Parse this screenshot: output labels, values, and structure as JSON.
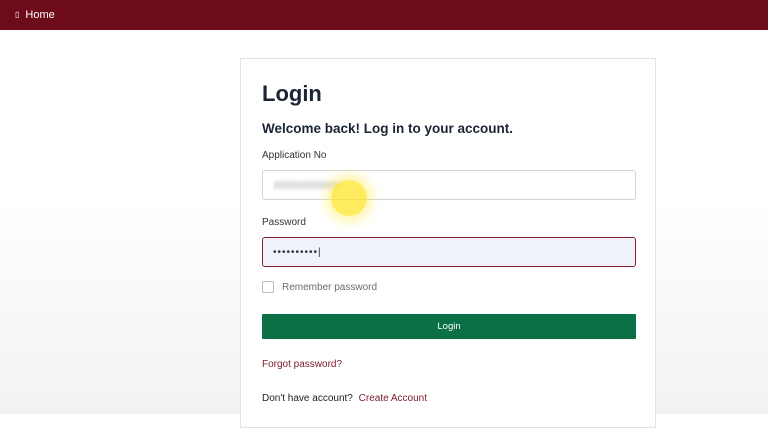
{
  "nav": {
    "home_icon": "home-icon",
    "home_icon_glyph": "▯",
    "home_label": "Home"
  },
  "login": {
    "title": "Login",
    "subtitle": "Welcome back! Log in to your account.",
    "application_no_label": "Application No",
    "application_no_value": "●●●●●●●●●●",
    "password_label": "Password",
    "password_value": "••••••••••|",
    "remember_label": "Remember password",
    "remember_checked": false,
    "submit_label": "Login",
    "forgot_label": "Forgot password?",
    "no_account_text": "Don't have account?",
    "create_account_label": "Create Account"
  },
  "colors": {
    "topbar": "#6e0b1a",
    "primary_button": "#0b7046",
    "link": "#7a1b2a"
  }
}
